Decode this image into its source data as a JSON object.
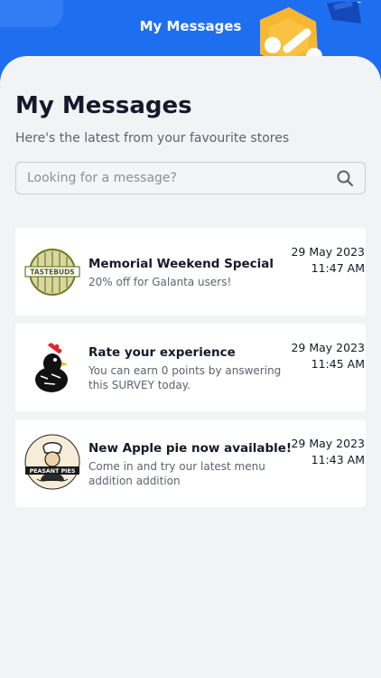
{
  "header": {
    "title": "My Messages"
  },
  "page": {
    "title": "My Messages",
    "subtitle": "Here's the latest from your favourite stores"
  },
  "search": {
    "placeholder": "Looking for a message?",
    "icon": "search-icon"
  },
  "messages": [
    {
      "logo_text": "TASTEBUDS",
      "title": "Memorial Weekend Special",
      "body": "20% off for Galanta users!",
      "date": "29 May 2023",
      "time": "11:47 AM"
    },
    {
      "logo_text": "",
      "title": "Rate your experience",
      "body": "You can earn 0 points by answering this SURVEY today.",
      "date": "29 May 2023",
      "time": "11:45 AM"
    },
    {
      "logo_text": "PEASANT PIES",
      "title": "New Apple pie now available!",
      "body": "Come in and try our latest menu addition addition",
      "date": "29 May 2023",
      "time": "11:43 AM"
    }
  ],
  "colors": {
    "header_bg": "#1e6ff0",
    "badge": "#f7b731",
    "text_dark": "#15192a",
    "text_muted": "#5d6272"
  }
}
